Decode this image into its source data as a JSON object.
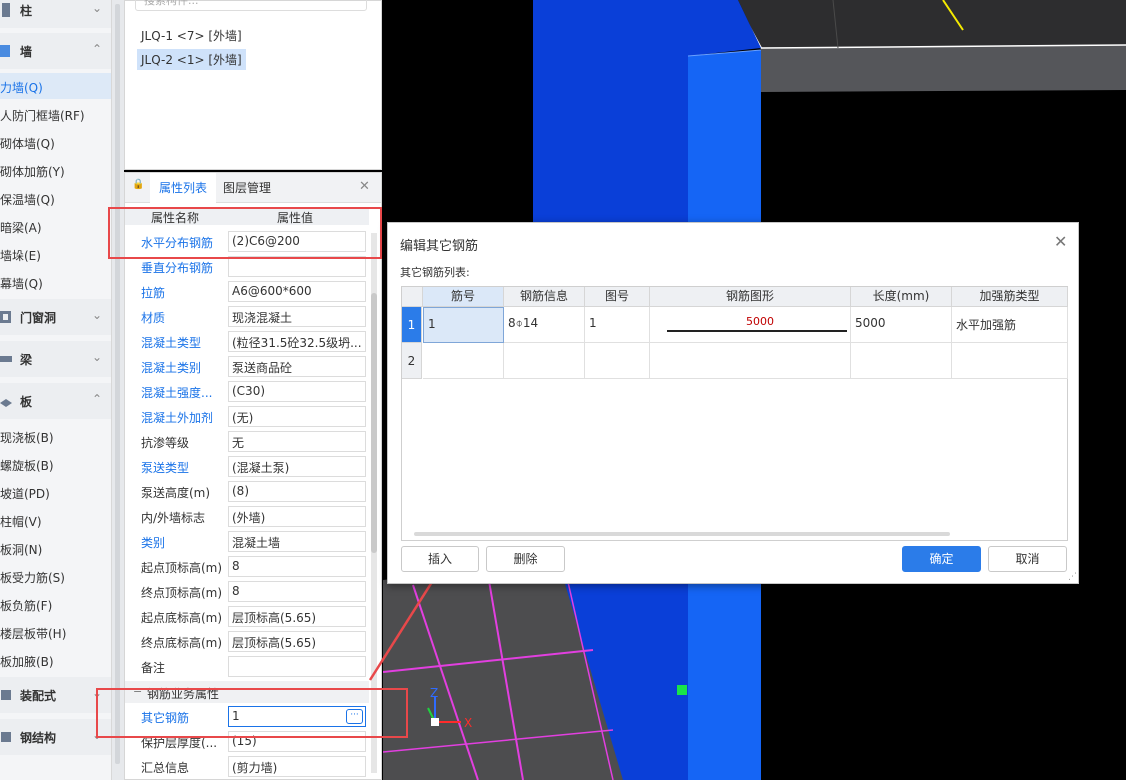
{
  "nav": {
    "groups": [
      {
        "label": "柱",
        "expanded": false
      },
      {
        "label": "墙",
        "expanded": true
      },
      {
        "label": "门窗洞",
        "expanded": false
      },
      {
        "label": "梁",
        "expanded": false
      },
      {
        "label": "板",
        "expanded": true
      },
      {
        "label": "装配式",
        "expanded": false
      },
      {
        "label": "钢结构",
        "expanded": false
      }
    ],
    "wall_items": [
      "力墙(Q)",
      "人防门框墙(RF)",
      "砌体墙(Q)",
      "砌体加筋(Y)",
      "保温墙(Q)",
      "暗梁(A)",
      "墙垛(E)",
      "幕墙(Q)"
    ],
    "slab_items": [
      "现浇板(B)",
      "螺旋板(B)",
      "坡道(PD)",
      "柱帽(V)",
      "板洞(N)",
      "板受力筋(S)",
      "板负筋(F)",
      "楼层板带(H)",
      "板加腋(B)"
    ]
  },
  "components": {
    "search_placeholder": "搜索构件...",
    "items": [
      "JLQ-1 <7> [外墙]",
      "JLQ-2 <1> [外墙]"
    ]
  },
  "properties": {
    "tabs": [
      "属性列表",
      "图层管理"
    ],
    "header": {
      "name": "属性名称",
      "value": "属性值"
    },
    "rows": [
      {
        "name": "水平分布钢筋",
        "value": "(2)C6@200",
        "link": true
      },
      {
        "name": "垂直分布钢筋",
        "value": "",
        "link": true
      },
      {
        "name": "拉筋",
        "value": "A6@600*600",
        "link": true
      },
      {
        "name": "材质",
        "value": "现浇混凝土",
        "link": true
      },
      {
        "name": "混凝土类型",
        "value": "(粒径31.5砼32.5级坍...",
        "link": true
      },
      {
        "name": "混凝土类别",
        "value": "泵送商品砼",
        "link": true
      },
      {
        "name": "混凝土强度...",
        "value": "(C30)",
        "link": true
      },
      {
        "name": "混凝土外加剂",
        "value": "(无)",
        "link": true
      },
      {
        "name": "抗渗等级",
        "value": "无",
        "link": false
      },
      {
        "name": "泵送类型",
        "value": "(混凝土泵)",
        "link": true
      },
      {
        "name": "泵送高度(m)",
        "value": "(8)",
        "link": false
      },
      {
        "name": "内/外墙标志",
        "value": "(外墙)",
        "link": false
      },
      {
        "name": "类别",
        "value": "混凝土墙",
        "link": true
      },
      {
        "name": "起点顶标高(m)",
        "value": "8",
        "link": false
      },
      {
        "name": "终点顶标高(m)",
        "value": "8",
        "link": false
      },
      {
        "name": "起点底标高(m)",
        "value": "层顶标高(5.65)",
        "link": false
      },
      {
        "name": "终点底标高(m)",
        "value": "层顶标高(5.65)",
        "link": false
      },
      {
        "name": "备注",
        "value": "",
        "link": false
      }
    ],
    "section": "钢筋业务属性",
    "section_rows": [
      {
        "name": "其它钢筋",
        "value": "1",
        "link": true
      },
      {
        "name": "保护层厚度(...",
        "value": "(15)",
        "link": false
      },
      {
        "name": "汇总信息",
        "value": "(剪力墙)",
        "link": false
      }
    ],
    "more_button": "···"
  },
  "dialog": {
    "title": "编辑其它钢筋",
    "list_label": "其它钢筋列表:",
    "columns": [
      "筋号",
      "钢筋信息",
      "图号",
      "钢筋图形",
      "长度(mm)",
      "加强筋类型"
    ],
    "rows": [
      {
        "index": "1",
        "cells": [
          "1",
          "8⌽14",
          "1",
          "5000",
          "5000",
          "水平加强筋"
        ]
      },
      {
        "index": "2",
        "cells": [
          "",
          "",
          "",
          "",
          "",
          ""
        ]
      }
    ],
    "buttons": {
      "insert": "插入",
      "delete": "删除",
      "ok": "确定",
      "cancel": "取消"
    }
  },
  "axes": {
    "x": "X",
    "z": "Z"
  },
  "colors": {
    "accent": "#1a73e8",
    "highlight": "#e8484a",
    "primary_button": "#2b7ce9",
    "wall_blue": "#0a3fd8",
    "slab_gray": "#4d4d4f"
  }
}
